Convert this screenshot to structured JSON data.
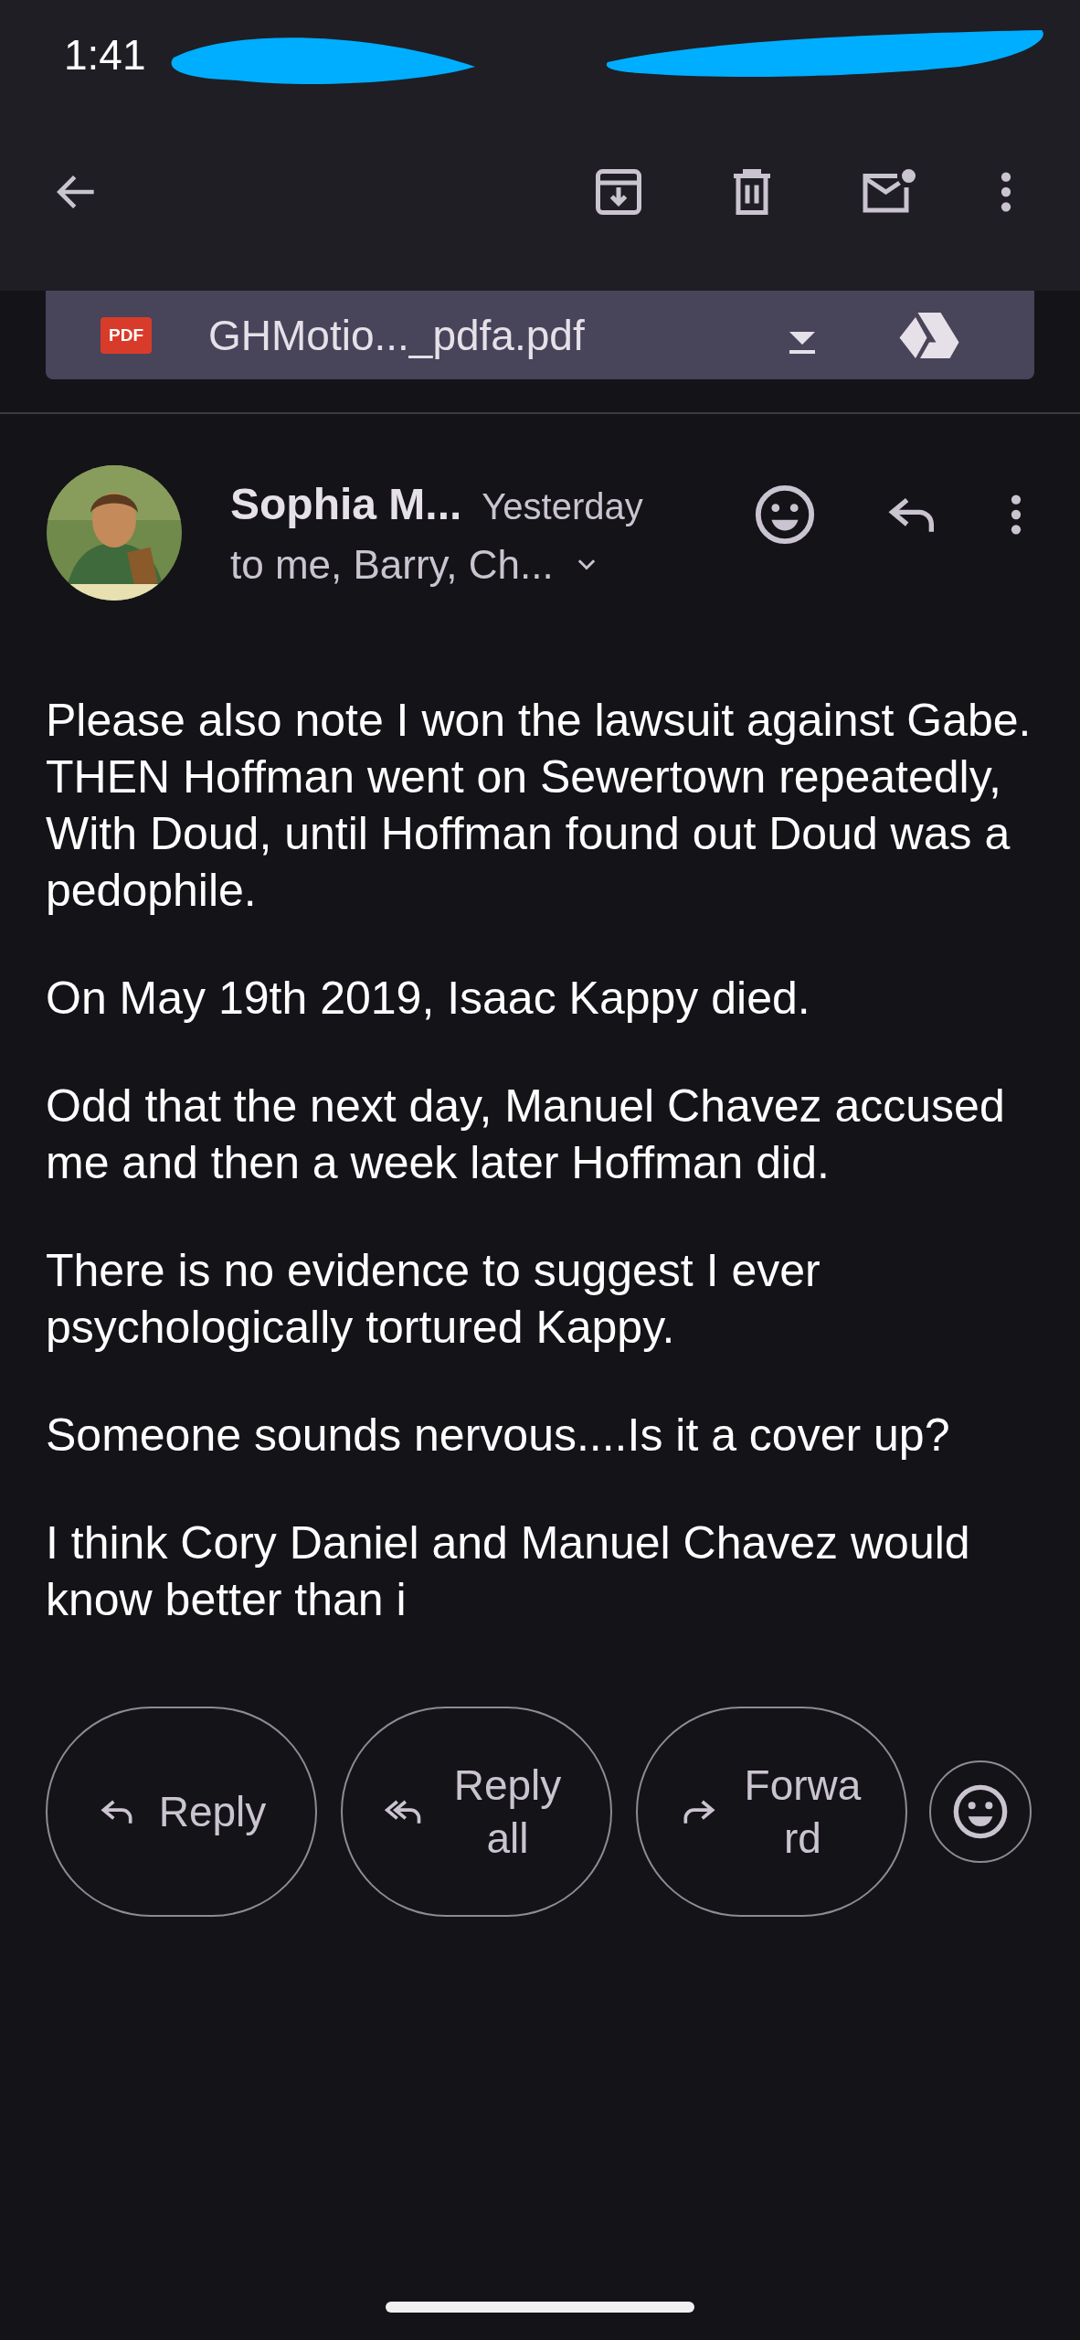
{
  "status_bar": {
    "time": "1:41"
  },
  "attachment": {
    "type_label": "PDF",
    "file_name": "GHMotio..._pdfa.pdf"
  },
  "message": {
    "sender": "Sophia M...",
    "date": "Yesterday",
    "recipients": "to me, Barry, Ch...",
    "body": [
      "Please also note I won the lawsuit against Gabe.\nTHEN Hoffman went on Sewertown repeatedly, With Doud, until Hoffman found out Doud was a pedophile.",
      "On May 19th 2019, Isaac Kappy died.",
      "Odd that the next day, Manuel Chavez accused me and then a week later Hoffman did.",
      "There is no evidence to suggest I ever psychologically tortured Kappy.",
      "Someone sounds nervous....Is it a cover up?",
      "I think Cory Daniel and Manuel Chavez would know better than i"
    ]
  },
  "actions": [
    {
      "kind": "reply",
      "label": "Reply"
    },
    {
      "kind": "reply_all",
      "label": "Reply all"
    },
    {
      "kind": "forward",
      "label": "Forward"
    },
    {
      "kind": "react"
    }
  ]
}
